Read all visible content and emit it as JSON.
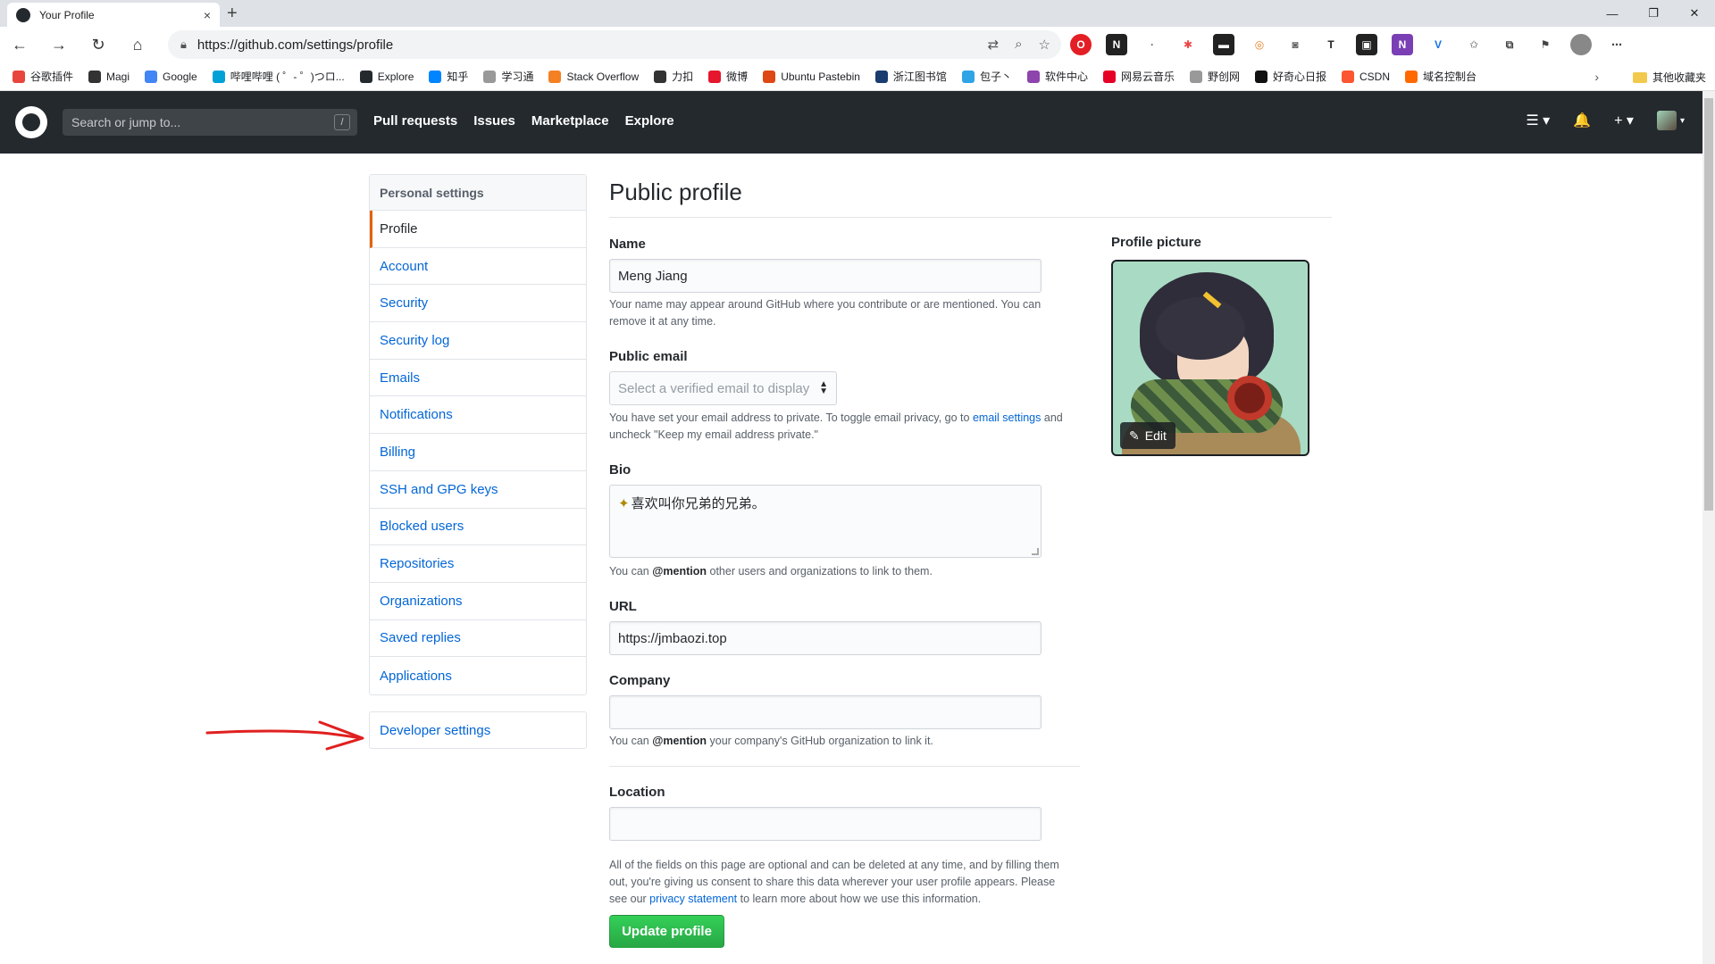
{
  "browser": {
    "tab_title": "Your Profile",
    "tab_close": "×",
    "new_tab": "+",
    "window_controls": [
      "—",
      "❐",
      "✕"
    ],
    "url": "https://github.com/settings/profile",
    "bookmarks": [
      {
        "label": "谷歌插件",
        "color": "#e8453c"
      },
      {
        "label": "Magi",
        "color": "#333333"
      },
      {
        "label": "Google",
        "color": "#4285f4"
      },
      {
        "label": "哔哩哔哩 ( ゜- ゜)つロ...",
        "color": "#00a1d6"
      },
      {
        "label": "Explore",
        "color": "#24292e"
      },
      {
        "label": "知乎",
        "color": "#0084ff"
      },
      {
        "label": "学习通",
        "color": "#999999"
      },
      {
        "label": "Stack Overflow",
        "color": "#f48024"
      },
      {
        "label": "力扣",
        "color": "#333333"
      },
      {
        "label": "微博",
        "color": "#e6162d"
      },
      {
        "label": "Ubuntu Pastebin",
        "color": "#dd4814"
      },
      {
        "label": "浙江图书馆",
        "color": "#1a3c6e"
      },
      {
        "label": "包子丶",
        "color": "#2fa4e7"
      },
      {
        "label": "软件中心",
        "color": "#8e44ad"
      },
      {
        "label": "网易云音乐",
        "color": "#e60026"
      },
      {
        "label": "野创网",
        "color": "#999999"
      },
      {
        "label": "好奇心日报",
        "color": "#111111"
      },
      {
        "label": "CSDN",
        "color": "#fc5531"
      },
      {
        "label": "域名控制台",
        "color": "#ff6a00"
      }
    ],
    "bookmarks_more": "›",
    "other_bookmarks": "其他收藏夹"
  },
  "github_header": {
    "search_placeholder": "Search or jump to...",
    "search_shortcut": "/",
    "nav": [
      "Pull requests",
      "Issues",
      "Marketplace",
      "Explore"
    ],
    "menu_icon": "☰ ▾",
    "bell_icon": "🔔",
    "plus_icon": "+ ▾",
    "avatar_caret": "▾"
  },
  "sidebar": {
    "heading": "Personal settings",
    "items": [
      "Profile",
      "Account",
      "Security",
      "Security log",
      "Emails",
      "Notifications",
      "Billing",
      "SSH and GPG keys",
      "Blocked users",
      "Repositories",
      "Organizations",
      "Saved replies",
      "Applications"
    ],
    "selected": "Profile",
    "developer_settings": "Developer settings"
  },
  "main": {
    "title": "Public profile",
    "name_label": "Name",
    "name_value": "Meng Jiang",
    "name_note": "Your name may appear around GitHub where you contribute or are mentioned. You can remove it at any time.",
    "email_label": "Public email",
    "email_placeholder": "Select a verified email to display",
    "email_note_1": "You have set your email address to private. To toggle email privacy, go to ",
    "email_note_link": "email settings",
    "email_note_2": " and uncheck \"Keep my email address private.\"",
    "bio_label": "Bio",
    "bio_value": "喜欢叫你兄弟的兄弟。",
    "bio_note_1": "You can ",
    "bio_note_mention": "@mention",
    "bio_note_2": " other users and organizations to link to them.",
    "url_label": "URL",
    "url_value": "https://jmbaozi.top",
    "company_label": "Company",
    "company_note_1": "You can ",
    "company_note_mention": "@mention",
    "company_note_2": " your company's GitHub organization to link it.",
    "location_label": "Location",
    "footer_note_1": "All of the fields on this page are optional and can be deleted at any time, and by filling them out, you're giving us consent to share this data wherever your user profile appears. Please see our ",
    "footer_note_link": "privacy statement",
    "footer_note_2": " to learn more about how we use this information.",
    "update_button": "Update profile",
    "picture_label": "Profile picture",
    "edit_button": "Edit"
  }
}
